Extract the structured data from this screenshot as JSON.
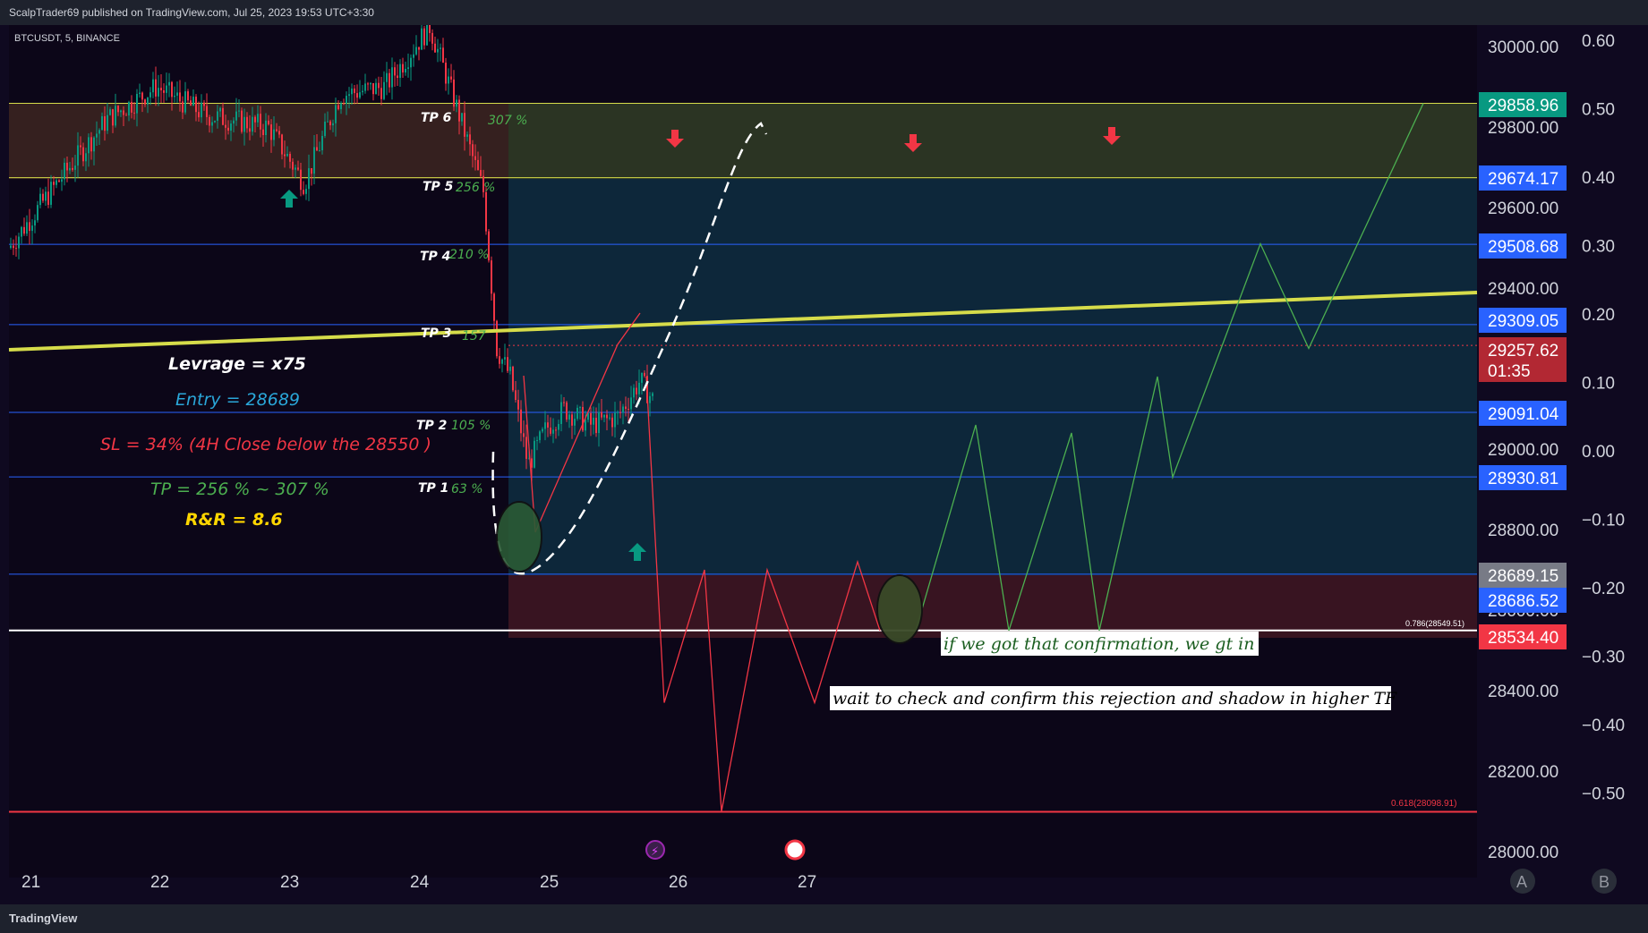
{
  "header": {
    "published": "ScalpTrader69 published on TradingView.com, Jul 25, 2023 19:53 UTC+3:30"
  },
  "symbol": "BTCUSDT, 5, BINANCE",
  "footer": {
    "brand": "TradingView"
  },
  "axis_buttons": {
    "a": "A",
    "b": "B"
  },
  "chart_data": {
    "type": "line",
    "x_axis": {
      "ticks": [
        "21",
        "22",
        "23",
        "24",
        "25",
        "26",
        "27"
      ]
    },
    "price_axis": {
      "ticks": [
        "30000.00",
        "29800.00",
        "29600.00",
        "29400.00",
        "29200.00",
        "29000.00",
        "28800.00",
        "28600.00",
        "28400.00",
        "28200.00",
        "28000.00"
      ]
    },
    "pct_axis": {
      "ticks": [
        "0.60",
        "0.50",
        "0.40",
        "0.30",
        "0.20",
        "0.10",
        "0.00",
        "−0.10",
        "−0.20",
        "−0.30",
        "−0.40",
        "−0.50"
      ]
    },
    "price_tags": [
      {
        "value": "29858.96",
        "color": "#089981"
      },
      {
        "value": "29674.17",
        "color": "#2962ff"
      },
      {
        "value": "29508.68",
        "color": "#2962ff"
      },
      {
        "value": "29309.05",
        "color": "#2962ff"
      },
      {
        "value": "29257.62",
        "sub": "01:35",
        "color": "#b22833"
      },
      {
        "value": "29091.04",
        "color": "#2962ff"
      },
      {
        "value": "28930.81",
        "color": "#2962ff"
      },
      {
        "value": "28689.15",
        "color": "#787b86"
      },
      {
        "value": "28686.52",
        "color": "#2962ff"
      },
      {
        "value": "28534.40",
        "color": "#f23645"
      }
    ],
    "levels": [
      29858.96,
      29674.17,
      29508.68,
      29309.05,
      29091.04,
      28930.81,
      28689.15,
      28549.51,
      28098.91
    ],
    "take_profits": [
      {
        "label": "TP 6",
        "pct": "307 %",
        "price": 29858.96
      },
      {
        "label": "TP 5",
        "pct": "256 %",
        "price": 29674.17
      },
      {
        "label": "TP 4",
        "pct": "210 %",
        "price": 29508.68
      },
      {
        "label": "TP 3",
        "pct": "157",
        "price": 29309.05
      },
      {
        "label": "TP 2",
        "pct": "105 %",
        "price": 29091.04
      },
      {
        "label": "TP 1",
        "pct": "63 %",
        "price": 28930.81
      }
    ],
    "fib_labels": [
      "0.786(28549.51)",
      "0.618(28098.91)"
    ],
    "trade_info": {
      "leverage": "Levrage = x75",
      "entry": "Entry = 28689",
      "sl": "SL = 34%  (4H Close below the 28550 )",
      "tp": "TP =  256 % ~ 307 %",
      "rr": "R&R  =  8.6"
    },
    "notes": {
      "confirm": "if we got that confirmation, we gt in",
      "wait": "wait to check and confirm this rejection and shadow in higher TF"
    },
    "trendline": {
      "from_price": 29180,
      "to_price": 29400
    },
    "bullish_projection": [
      28549,
      28260,
      29060,
      28549,
      29040,
      28549,
      29180,
      28930,
      29510,
      29250,
      29858.96
    ],
    "bearish_projection": [
      29180,
      28560,
      28370,
      28700,
      28100,
      28700,
      28370,
      28720,
      28549
    ],
    "colors": {
      "bull": "#089981",
      "bear": "#f23645",
      "trendline": "#d6dc4a"
    }
  }
}
